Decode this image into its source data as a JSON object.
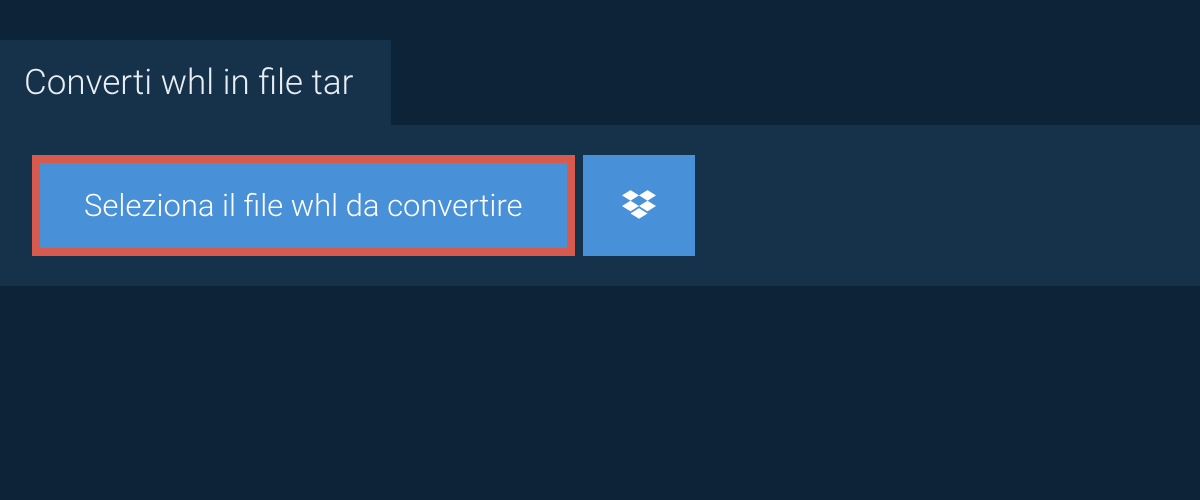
{
  "tab": {
    "label": "Converti whl in file tar"
  },
  "upload": {
    "select_label": "Seleziona il file whl da convertire"
  }
}
